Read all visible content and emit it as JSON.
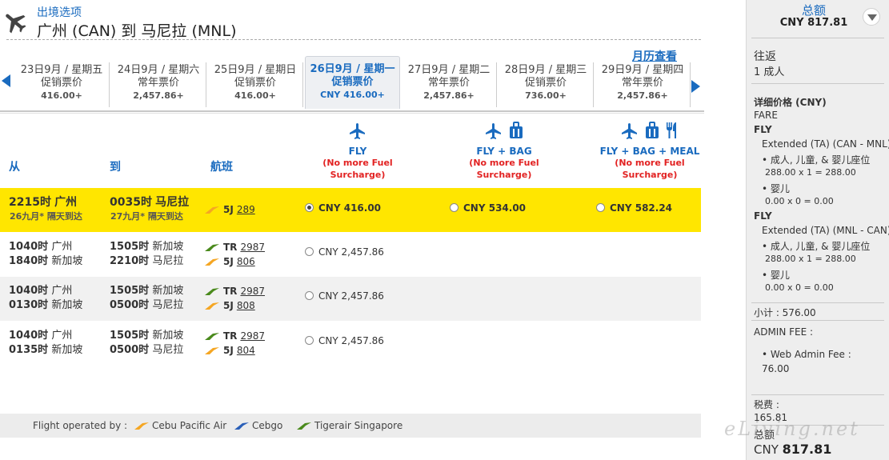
{
  "header": {
    "section_label": "出境选项",
    "route": "广州 (CAN) 到 马尼拉 (MNL)"
  },
  "calendar_link": "月历查看",
  "dates": [
    {
      "date": "23日9月 / 星期五",
      "type": "促销票价",
      "price": "416.00+"
    },
    {
      "date": "24日9月 / 星期六",
      "type": "常年票价",
      "price": "2,457.86+"
    },
    {
      "date": "25日9月 / 星期日",
      "type": "促销票价",
      "price": "416.00+"
    },
    {
      "date": "26日9月 / 星期一",
      "type": "促销票价",
      "price": "CNY 416.00+",
      "selected": true
    },
    {
      "date": "27日9月 / 星期二",
      "type": "常年票价",
      "price": "2,457.86+"
    },
    {
      "date": "28日9月 / 星期三",
      "type": "促销票价",
      "price": "736.00+"
    },
    {
      "date": "29日9月 / 星期四",
      "type": "常年票价",
      "price": "2,457.86+"
    }
  ],
  "columns": {
    "from": "从",
    "to": "到",
    "flight": "航班"
  },
  "fare_types": [
    {
      "name": "FLY",
      "note1": "(No more Fuel",
      "note2": "Surcharge)"
    },
    {
      "name": "FLY + BAG",
      "note1": "(No more Fuel",
      "note2": "Surcharge)"
    },
    {
      "name": "FLY + BAG + MEAL",
      "note1": "(No more Fuel",
      "note2": "Surcharge)"
    }
  ],
  "rows": [
    {
      "dep": [
        {
          "time": "2215时",
          "city": "广州"
        }
      ],
      "dep_note": "26九月* 隔天到达",
      "arr": [
        {
          "time": "0035时",
          "city": "马尼拉"
        }
      ],
      "arr_note": "27九月* 隔天到达",
      "flights": [
        {
          "code": "5J",
          "num": "289",
          "airline": "cebu"
        }
      ],
      "prices": [
        "CNY 416.00",
        "CNY 534.00",
        "CNY 582.24"
      ],
      "selected": 0
    },
    {
      "dep": [
        {
          "time": "1040时",
          "city": "广州"
        },
        {
          "time": "1840时",
          "city": "新加坡"
        }
      ],
      "arr": [
        {
          "time": "1505时",
          "city": "新加坡"
        },
        {
          "time": "2210时",
          "city": "马尼拉"
        }
      ],
      "flights": [
        {
          "code": "TR",
          "num": "2987",
          "airline": "tigerair"
        },
        {
          "code": "5J",
          "num": "806",
          "airline": "cebu"
        }
      ],
      "prices": [
        "CNY 2,457.86"
      ]
    },
    {
      "dep": [
        {
          "time": "1040时",
          "city": "广州"
        },
        {
          "time": "0130时",
          "city": "新加坡"
        }
      ],
      "arr": [
        {
          "time": "1505时",
          "city": "新加坡"
        },
        {
          "time": "0500时",
          "city": "马尼拉"
        }
      ],
      "flights": [
        {
          "code": "TR",
          "num": "2987",
          "airline": "tigerair"
        },
        {
          "code": "5J",
          "num": "808",
          "airline": "cebu"
        }
      ],
      "prices": [
        "CNY 2,457.86"
      ]
    },
    {
      "dep": [
        {
          "time": "1040时",
          "city": "广州"
        },
        {
          "time": "0135时",
          "city": "新加坡"
        }
      ],
      "arr": [
        {
          "time": "1505时",
          "city": "新加坡"
        },
        {
          "time": "0500时",
          "city": "马尼拉"
        }
      ],
      "flights": [
        {
          "code": "TR",
          "num": "2987",
          "airline": "tigerair"
        },
        {
          "code": "5J",
          "num": "804",
          "airline": "cebu"
        }
      ],
      "prices": [
        "CNY 2,457.86"
      ]
    }
  ],
  "footer": {
    "label": "Flight operated by :",
    "operators": [
      {
        "name": "Cebu Pacific Air",
        "airline": "cebu"
      },
      {
        "name": "Cebgo",
        "airline": "cebgo"
      },
      {
        "name": "Tigerair Singapore",
        "airline": "tigerair"
      }
    ]
  },
  "sidebar": {
    "total_label": "总额",
    "total_value": "CNY 817.81",
    "trip_label": "往返",
    "passengers": "1 成人",
    "detail_title": "详细价格 (CNY)",
    "fare_label": "FARE",
    "segments": [
      {
        "label": "FLY",
        "name": "Extended (TA) (CAN - MNL)",
        "p1": "• 成人, 儿童, & 婴儿座位",
        "p1_calc": "288.00 x 1 = 288.00",
        "p2": "• 婴儿",
        "p2_calc": "0.00 x 0 = 0.00"
      },
      {
        "label": "FLY",
        "name": "Extended (TA) (MNL - CAN)",
        "p1": "• 成人, 儿童, & 婴儿座位",
        "p1_calc": "288.00 x 1 = 288.00",
        "p2": "• 婴儿",
        "p2_calc": "0.00 x 0 = 0.00"
      }
    ],
    "subtotal": "小计 : 576.00",
    "admin_label": "ADMIN FEE :",
    "admin_item": "• Web Admin Fee :",
    "admin_value": "76.00",
    "tax_label": "税费 :",
    "tax_value": "165.81",
    "bottom_total_label": "总额",
    "bottom_currency": "CNY",
    "bottom_total_value": "817.81"
  },
  "watermark": "eLiving.net",
  "colors": {
    "accent": "#1a6bbf",
    "highlight": "#ffe600",
    "note_red": "#e22222",
    "cebu": "#f5a623",
    "tigerair": "#4a8a1c",
    "cebgo": "#2a5fb8"
  }
}
